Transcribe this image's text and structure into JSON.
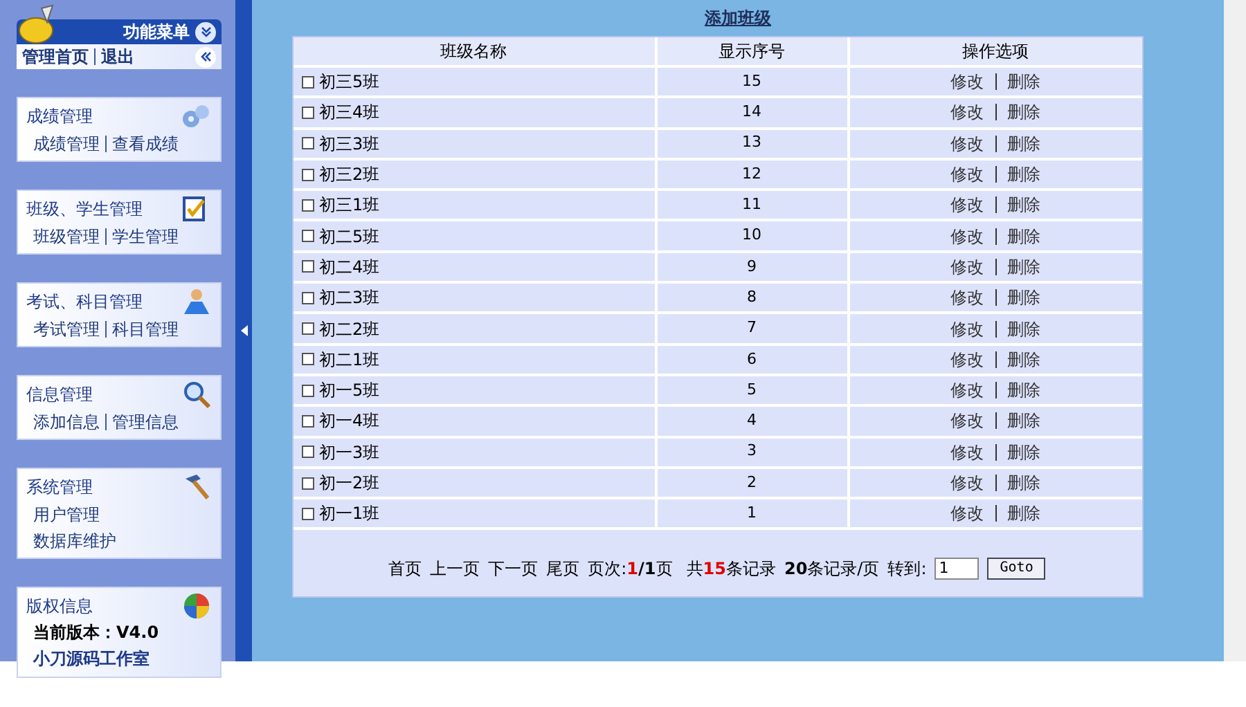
{
  "sidebar": {
    "menu_title": "功能菜单",
    "home_links": [
      "管理首页",
      "退出"
    ],
    "sections": [
      {
        "title": "成绩管理",
        "lines": [
          [
            "成绩管理",
            "查看成绩"
          ]
        ]
      },
      {
        "title": "班级、学生管理",
        "lines": [
          [
            "班级管理",
            "学生管理"
          ]
        ]
      },
      {
        "title": "考试、科目管理",
        "lines": [
          [
            "考试管理",
            "科目管理"
          ]
        ]
      },
      {
        "title": "信息管理",
        "lines": [
          [
            "添加信息",
            "管理信息"
          ]
        ]
      },
      {
        "title": "系统管理",
        "lines": [
          [
            "用户管理"
          ],
          [
            "数据库维护"
          ]
        ]
      },
      {
        "title": "版权信息",
        "version": "当前版本：V4.0",
        "studio": "小刀源码工作室"
      }
    ]
  },
  "main": {
    "title": "添加班级",
    "table": {
      "columns": [
        "班级名称",
        "显示序号",
        "操作选项"
      ],
      "rows": [
        {
          "name": "初三5班",
          "order": "15",
          "checked": false,
          "actions": [
            "修改",
            "删除"
          ]
        },
        {
          "name": "初三4班",
          "order": "14",
          "checked": false,
          "actions": [
            "修改",
            "删除"
          ]
        },
        {
          "name": "初三3班",
          "order": "13",
          "checked": false,
          "actions": [
            "修改",
            "删除"
          ]
        },
        {
          "name": "初三2班",
          "order": "12",
          "checked": false,
          "actions": [
            "修改",
            "删除"
          ]
        },
        {
          "name": "初三1班",
          "order": "11",
          "checked": false,
          "actions": [
            "修改",
            "删除"
          ]
        },
        {
          "name": "初二5班",
          "order": "10",
          "checked": false,
          "actions": [
            "修改",
            "删除"
          ]
        },
        {
          "name": "初二4班",
          "order": "9",
          "checked": false,
          "actions": [
            "修改",
            "删除"
          ]
        },
        {
          "name": "初二3班",
          "order": "8",
          "checked": false,
          "actions": [
            "修改",
            "删除"
          ]
        },
        {
          "name": "初二2班",
          "order": "7",
          "checked": false,
          "actions": [
            "修改",
            "删除"
          ]
        },
        {
          "name": "初二1班",
          "order": "6",
          "checked": false,
          "actions": [
            "修改",
            "删除"
          ]
        },
        {
          "name": "初一5班",
          "order": "5",
          "checked": false,
          "actions": [
            "修改",
            "删除"
          ]
        },
        {
          "name": "初一4班",
          "order": "4",
          "checked": false,
          "actions": [
            "修改",
            "删除"
          ]
        },
        {
          "name": "初一3班",
          "order": "3",
          "checked": false,
          "actions": [
            "修改",
            "删除"
          ]
        },
        {
          "name": "初一2班",
          "order": "2",
          "checked": false,
          "actions": [
            "修改",
            "删除"
          ]
        },
        {
          "name": "初一1班",
          "order": "1",
          "checked": false,
          "actions": [
            "修改",
            "删除"
          ]
        }
      ]
    },
    "pager": {
      "links": [
        "首页",
        "上一页",
        "下一页",
        "尾页"
      ],
      "page_label": "页次:",
      "page_current": "1",
      "page_total": "/1",
      "page_suffix": "页",
      "total_prefix": "共",
      "total_count": "15",
      "total_suffix": "条记录",
      "per_page": "**20**条记录/页",
      "goto_label": "转到:",
      "goto_value": "1",
      "goto_button": "Goto"
    }
  }
}
